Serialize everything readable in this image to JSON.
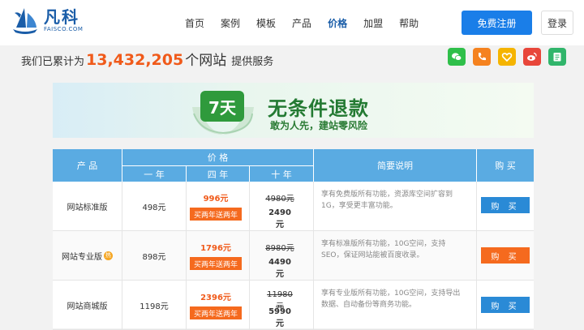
{
  "brand": {
    "name_cn": "凡科",
    "name_en": "FAISCO.COM"
  },
  "nav": [
    {
      "label": "首页",
      "active": false
    },
    {
      "label": "案例",
      "active": false
    },
    {
      "label": "模板",
      "active": false
    },
    {
      "label": "产品",
      "active": false
    },
    {
      "label": "价格",
      "active": true
    },
    {
      "label": "加盟",
      "active": false
    },
    {
      "label": "帮助",
      "active": false
    }
  ],
  "header": {
    "register_label": "免费注册",
    "login_label": "登录"
  },
  "stats": {
    "prefix": "我们已累计为",
    "number": "13,432,205",
    "unit": "个网站",
    "suffix": "提供服务"
  },
  "social": [
    {
      "icon": "wechat-icon",
      "color": "#2fbf4a"
    },
    {
      "icon": "phone-icon",
      "color": "#f5821f"
    },
    {
      "icon": "heart-icon",
      "color": "#f5b400"
    },
    {
      "icon": "weibo-icon",
      "color": "#e8463a"
    },
    {
      "icon": "notepad-icon",
      "color": "#31b56b"
    }
  ],
  "banner": {
    "badge": "7天",
    "title": "无条件退款",
    "subtitle": "敢为人先，建站零风险"
  },
  "table": {
    "headers": {
      "product": "产 品",
      "price": "价 格",
      "one_year": "一 年",
      "four_years": "四 年",
      "ten_years": "十 年",
      "desc": "简要说明",
      "buy": "购 买"
    },
    "rows": [
      {
        "name": "网站标准版",
        "hot": "",
        "one_year": "498元",
        "four_years": "996元",
        "promo": "买两年送两年",
        "ten_years_old": "4980元",
        "ten_years": "2490元",
        "desc": "享有免费版所有功能，资源库空间扩容到1G，享受更丰富功能。",
        "buy": "购 买",
        "buy_color": "blue"
      },
      {
        "name": "网站专业版",
        "hot": "热",
        "one_year": "898元",
        "four_years": "1796元",
        "promo": "买两年送两年",
        "ten_years_old": "8980元",
        "ten_years": "4490元",
        "desc": "享有标准版所有功能，10G空间，支持SEO，保证网站能被百度收录。",
        "buy": "购 买",
        "buy_color": "orange"
      },
      {
        "name": "网站商城版",
        "hot": "",
        "one_year": "1198元",
        "four_years": "2396元",
        "promo": "买两年送两年",
        "ten_years_old": "11980元",
        "ten_years": "5990元",
        "desc": "享有专业版所有功能，10G空间，支持导出数据、自动备份等商务功能。",
        "buy": "购 买",
        "buy_color": "blue"
      }
    ]
  }
}
